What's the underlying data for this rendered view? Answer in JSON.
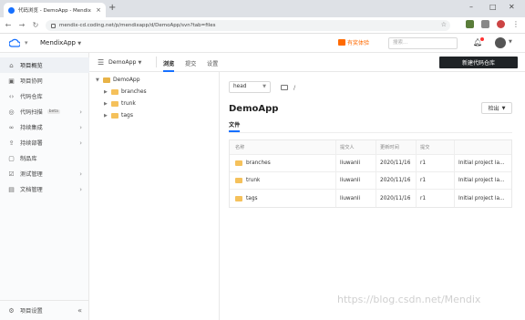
{
  "browser": {
    "tab_title": "代码浏览 - DemoApp - Mendix",
    "new_tab": "+",
    "url": "mendix-cd.coding.net/p/mendixapp/d/DemoApp/svn?tab=files",
    "window_controls": [
      "–",
      "□",
      "✕"
    ]
  },
  "app": {
    "project_name": "MendixApp",
    "promo_label": "有奖体验",
    "search_placeholder": "搜索...",
    "accent_color": "#1670ff",
    "promo_color": "#ff6a00"
  },
  "sidebar": {
    "items": [
      {
        "label": "项目概览",
        "icon": "home-icon",
        "glyph": "⌂",
        "chevron": false,
        "active": true
      },
      {
        "label": "项目协同",
        "icon": "task-icon",
        "glyph": "▣",
        "chevron": false
      },
      {
        "label": "代码仓库",
        "icon": "code-icon",
        "glyph": "‹›",
        "chevron": false
      },
      {
        "label": "代码扫描",
        "icon": "scan-icon",
        "glyph": "◎",
        "chevron": true,
        "badge": "beta"
      },
      {
        "label": "持续集成",
        "icon": "ci-icon",
        "glyph": "∞",
        "chevron": true
      },
      {
        "label": "持续部署",
        "icon": "deploy-icon",
        "glyph": "⇪",
        "chevron": true
      },
      {
        "label": "制品库",
        "icon": "artifact-icon",
        "glyph": "▢",
        "chevron": false
      },
      {
        "label": "测试管理",
        "icon": "test-icon",
        "glyph": "☑",
        "chevron": true
      },
      {
        "label": "文档管理",
        "icon": "doc-icon",
        "glyph": "▤",
        "chevron": true
      }
    ],
    "footer_label": "项目设置",
    "collapse_glyph": "«"
  },
  "subbar": {
    "repo_name": "DemoApp",
    "tabs": [
      "浏览",
      "提交",
      "设置"
    ],
    "new_repo_label": "新建代码仓库"
  },
  "tree": {
    "root": "DemoApp",
    "children": [
      "branches",
      "trunk",
      "tags"
    ]
  },
  "main": {
    "ref": "head",
    "path_sep": "/",
    "title": "DemoApp",
    "checkout_label": "检出",
    "files_tab": "文件",
    "columns": [
      "名称",
      "提交人",
      "更新时间",
      "提交",
      ""
    ],
    "rows": [
      {
        "name": "branches",
        "author": "liuwanli",
        "time": "2020/11/16",
        "commit": "r1",
        "message": "Initial project la..."
      },
      {
        "name": "trunk",
        "author": "liuwanli",
        "time": "2020/11/16",
        "commit": "r1",
        "message": "Initial project la..."
      },
      {
        "name": "tags",
        "author": "liuwanli",
        "time": "2020/11/16",
        "commit": "r1",
        "message": "Initial project la..."
      }
    ]
  },
  "watermark": "https://blog.csdn.net/Mendix"
}
